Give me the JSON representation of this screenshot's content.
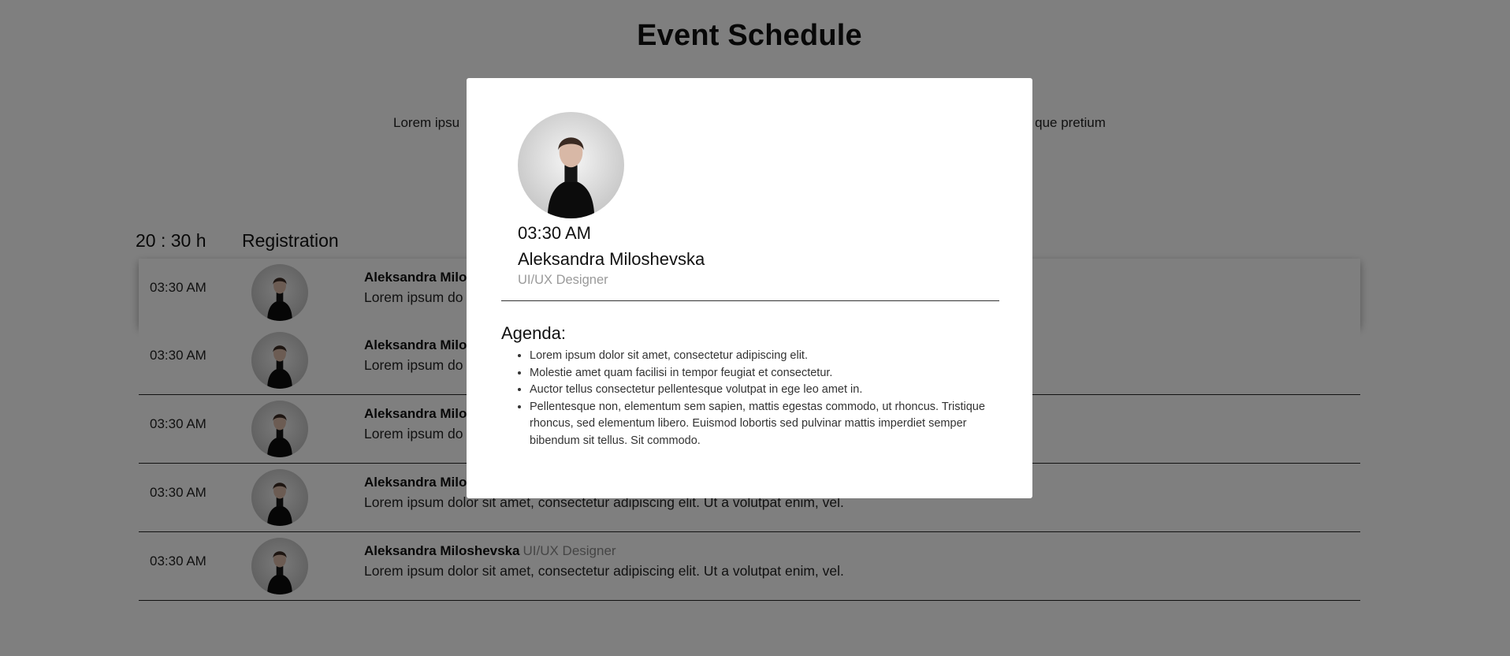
{
  "page": {
    "title": "Event Schedule",
    "intro_left": "Lorem ipsu",
    "intro_right": "que pretium"
  },
  "session": {
    "time": "20 : 30 h",
    "title": "Registration"
  },
  "schedule": {
    "rows": [
      {
        "time": "03:30 AM",
        "name": "Aleksandra Milo",
        "role": "",
        "description": "Lorem ipsum do"
      },
      {
        "time": "03:30 AM",
        "name": "Aleksandra Milo",
        "role": "",
        "description": "Lorem ipsum do"
      },
      {
        "time": "03:30 AM",
        "name": "Aleksandra Milo",
        "role": "",
        "description": "Lorem ipsum do"
      },
      {
        "time": "03:30 AM",
        "name": "Aleksandra Milo",
        "role": "",
        "description": "Lorem ipsum dolor sit amet, consectetur adipiscing elit. Ut a volutpat enim, vel."
      },
      {
        "time": "03:30 AM",
        "name": "Aleksandra Miloshevska",
        "role": "UI/UX Designer",
        "description": "Lorem ipsum dolor sit amet, consectetur adipiscing elit. Ut a volutpat enim, vel."
      }
    ]
  },
  "modal": {
    "time": "03:30 AM",
    "name": "Aleksandra Miloshevska",
    "role": "UI/UX Designer",
    "agenda_title": "Agenda:",
    "agenda_items": [
      "Lorem ipsum dolor sit amet, consectetur adipiscing elit.",
      "Molestie amet quam facilisi in tempor feugiat et consectetur.",
      "Auctor tellus consectetur pellentesque volutpat in ege leo amet in.",
      "Pellentesque non, elementum sem sapien, mattis egestas commodo, ut rhoncus. Tristique rhoncus, sed elementum libero. Euismod lobortis sed pulvinar mattis imperdiet semper bibendum sit tellus. Sit commodo."
    ]
  },
  "colors": {
    "overlay": "#000000",
    "role_gray": "#8a8a8a",
    "divider": "#222222"
  }
}
